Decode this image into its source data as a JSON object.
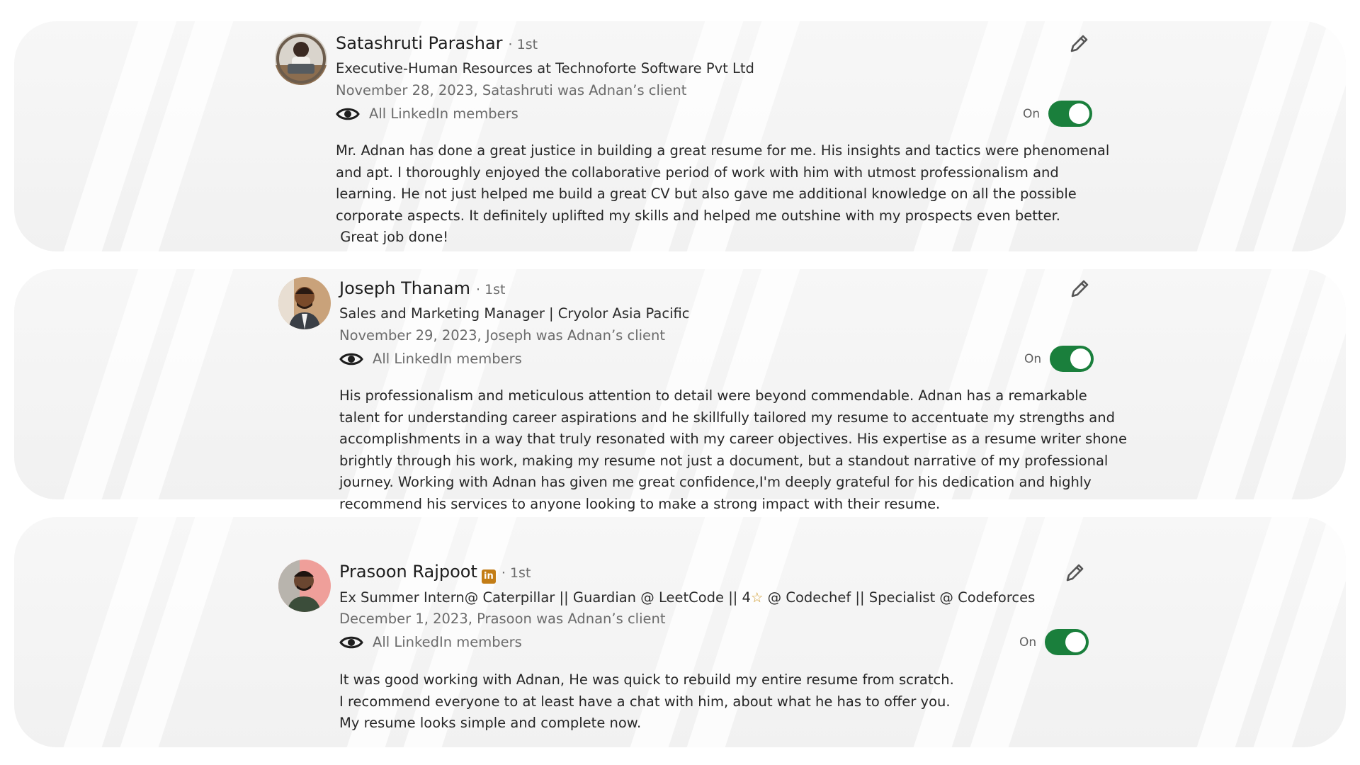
{
  "recommendations": [
    {
      "name": "Satashruti Parashar",
      "degree": "· 1st",
      "headline": "Executive-Human Resources at Technoforte Software Pvt Ltd",
      "date": "November 28, 2023, Satashruti was Adnan’s client",
      "visibility": "All LinkedIn members",
      "toggle_label": "On",
      "toggle_on": true,
      "text_lines": [
        "Mr. Adnan has done a great justice in building a great resume for me. His insights and tactics were phenomenal",
        "and apt. I thoroughly enjoyed the collaborative period of work with him with utmost professionalism and",
        "learning. He not just helped me build a great CV but also gave me additional knowledge on all the possible",
        "corporate aspects. It definitely uplifted my skills and helped me outshine with my prospects even better.",
        " Great job done!"
      ]
    },
    {
      "name": "Joseph Thanam",
      "degree": "· 1st",
      "headline": "Sales and Marketing Manager | Cryolor Asia Pacific",
      "date": "November 29, 2023, Joseph was Adnan’s client",
      "visibility": "All LinkedIn members",
      "toggle_label": "On",
      "toggle_on": true,
      "text_lines": [
        "His professionalism and meticulous attention to detail were beyond commendable. Adnan has a remarkable",
        "talent for understanding career aspirations and he skillfully tailored my resume to accentuate my strengths and",
        "accomplishments in a way that truly resonated with my career objectives. His expertise as a resume writer shone",
        "brightly through his work, making my resume not just a document, but a standout narrative of my professional",
        "journey. Working with Adnan has given me great confidence,I'm deeply grateful for his dedication and highly",
        "recommend his services to anyone looking to make a strong impact with their resume."
      ]
    },
    {
      "name": "Prasoon Rajpoot",
      "badge": "in",
      "degree": "· 1st",
      "headline_pre": "Ex Summer Intern@ Caterpillar || Guardian @ LeetCode || 4",
      "headline_star": "☆",
      "headline_post": " @ Codechef || Specialist @ Codeforces",
      "date": "December 1, 2023, Prasoon was Adnan’s client",
      "visibility": "All LinkedIn members",
      "toggle_label": "On",
      "toggle_on": true,
      "text_lines": [
        "It was good working with Adnan, He was quick to rebuild my entire resume from scratch.",
        "I recommend everyone to at least have a chat with him, about what he has to offer you.",
        "My resume looks simple and complete now."
      ]
    }
  ],
  "icons": {
    "edit": "pencil-icon",
    "visibility": "eye-icon",
    "toggle": "toggle-switch"
  },
  "colors": {
    "toggle_on": "#1a7f3c",
    "badge": "#c37d16",
    "secondary_text": "#6b6b6b"
  }
}
